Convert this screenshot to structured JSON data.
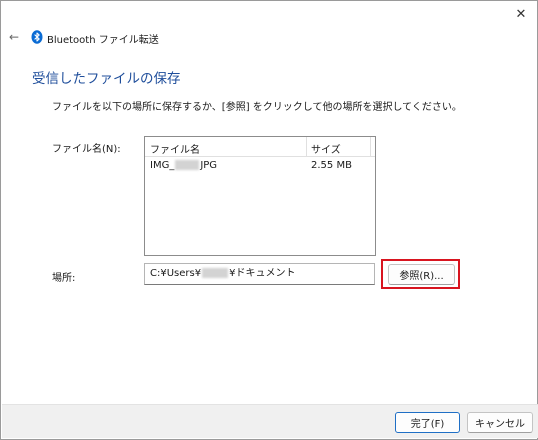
{
  "titlebar": {
    "close_glyph": "✕"
  },
  "nav": {
    "back_glyph": "←",
    "title": "Bluetooth ファイル転送",
    "icon": "bluetooth-icon"
  },
  "heading": "受信したファイルの保存",
  "instruction": "ファイルを以下の場所に保存するか、[参照] をクリックして他の場所を選択してください。",
  "file_name_label": "ファイル名(N):",
  "file_list": {
    "columns": [
      "ファイル名",
      "サイズ"
    ],
    "rows": [
      {
        "name_prefix": "IMG_",
        "name_suffix": "JPG",
        "size": "2.55 MB"
      }
    ]
  },
  "location_label": "場所:",
  "location": {
    "prefix": "C:¥Users¥",
    "suffix": "¥ドキュメント"
  },
  "browse_button": "参照(R)...",
  "footer": {
    "ok": "完了(F)",
    "cancel": "キャンセル"
  },
  "colors": {
    "heading": "#1f4e9b",
    "highlight": "#d8141f",
    "bluetooth": "#0a6bd4"
  }
}
